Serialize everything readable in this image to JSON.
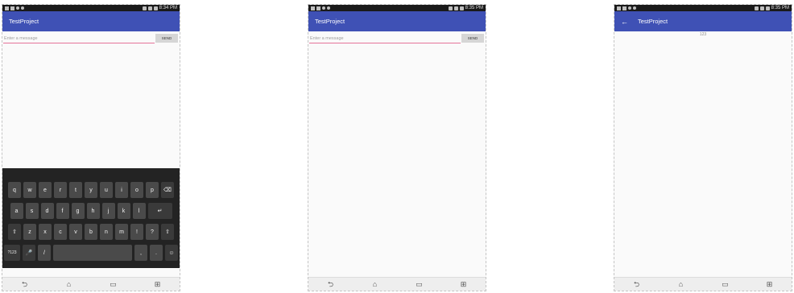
{
  "colors": {
    "appbar": "#3f51b5",
    "statusbar": "#1a1a1a",
    "input_underline": "#e57399",
    "send_bg": "#d6d6d6",
    "keyboard_bg": "#232323"
  },
  "icons": {
    "back": "arrow-left-icon",
    "nav": [
      "back-nav-icon",
      "home-nav-icon",
      "recents-nav-icon",
      "grid-nav-icon"
    ]
  },
  "screens": [
    {
      "status_time": "8:34 PM",
      "app_title": "TestProject",
      "message_placeholder": "Enter a message",
      "send_label": "SEND",
      "keyboard": {
        "row1": [
          "q",
          "w",
          "e",
          "r",
          "t",
          "y",
          "u",
          "i",
          "o",
          "p",
          "⌫"
        ],
        "row2": [
          "a",
          "s",
          "d",
          "f",
          "g",
          "h",
          "j",
          "k",
          "l",
          "↵"
        ],
        "row3": [
          "⇧",
          "z",
          "x",
          "c",
          "v",
          "b",
          "n",
          "m",
          "!",
          "?",
          "⇧"
        ],
        "row4_left": [
          "?123",
          "🎤",
          "/"
        ],
        "row4_right": [
          ",",
          ".",
          "☺"
        ]
      }
    },
    {
      "status_time": "8:35 PM",
      "app_title": "TestProject",
      "message_placeholder": "Enter a message",
      "send_label": "SEND"
    },
    {
      "status_time": "8:35 PM",
      "app_title": "TestProject",
      "displayed_message": "123"
    }
  ]
}
